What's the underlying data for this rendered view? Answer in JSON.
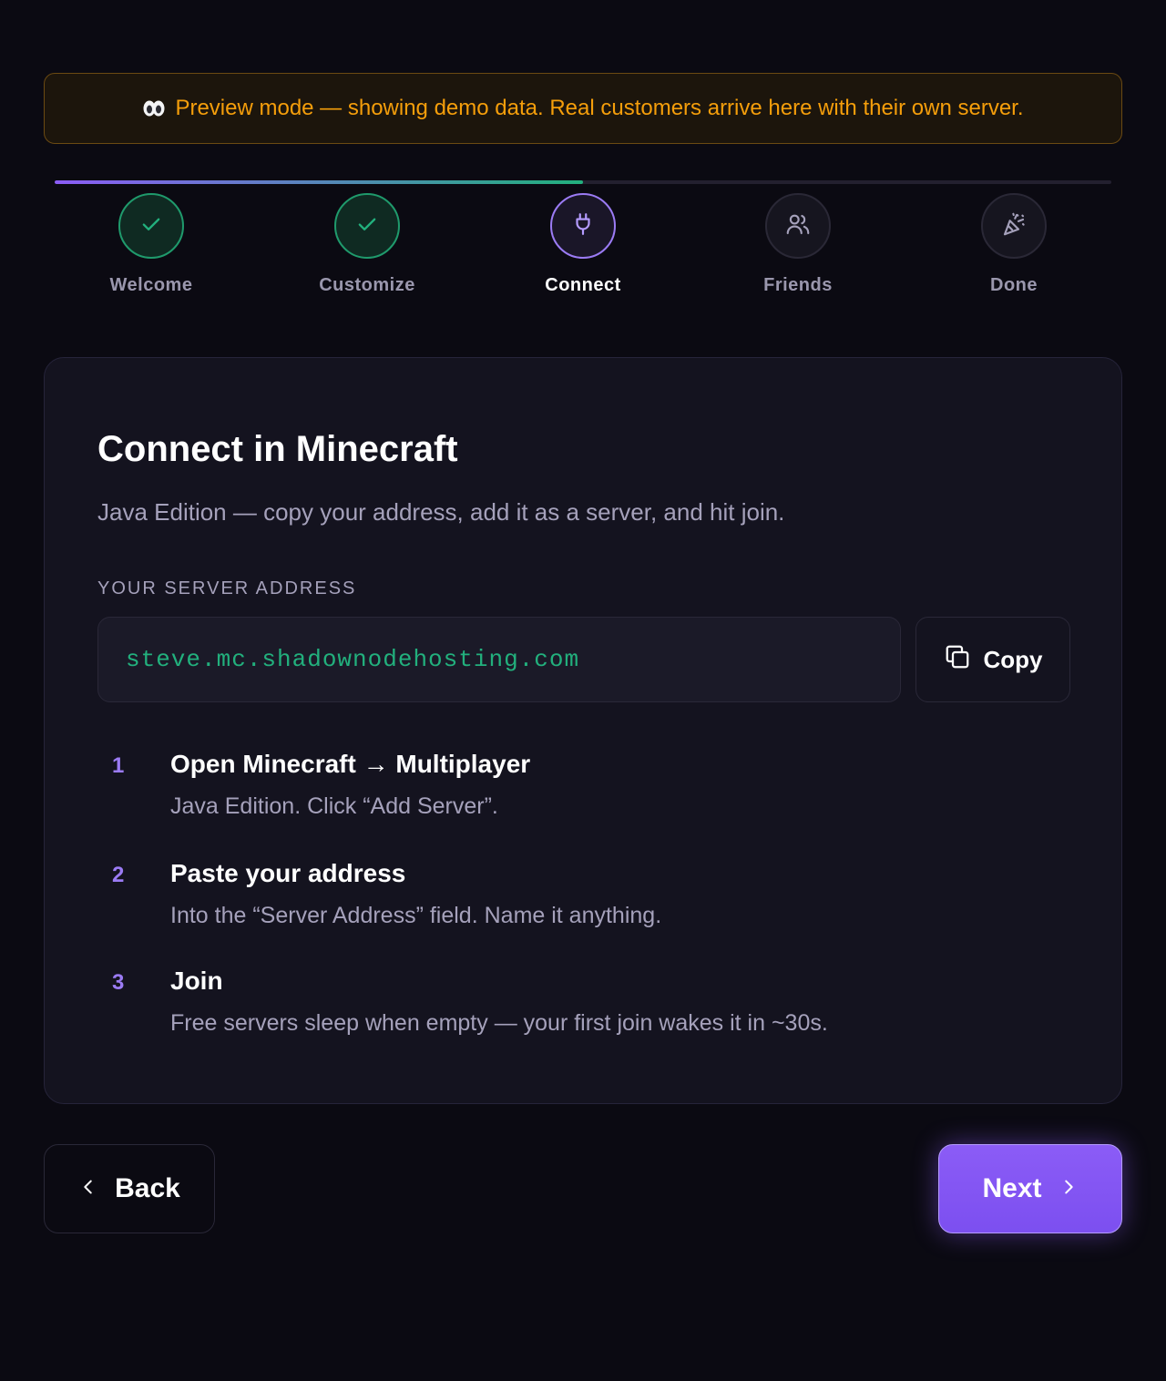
{
  "banner": {
    "icon": "eyes-icon",
    "text": "Preview mode — showing demo data. Real customers arrive here with their own server."
  },
  "progress": {
    "fraction": 0.5,
    "gradient_start": "#8b5cf6",
    "gradient_end": "#22b07d"
  },
  "steps": [
    {
      "label": "Welcome",
      "state": "done",
      "icon": "check-icon"
    },
    {
      "label": "Customize",
      "state": "done",
      "icon": "check-icon"
    },
    {
      "label": "Connect",
      "state": "active",
      "icon": "plug-icon"
    },
    {
      "label": "Friends",
      "state": "pending",
      "icon": "users-icon"
    },
    {
      "label": "Done",
      "state": "pending",
      "icon": "party-popper-icon"
    }
  ],
  "card": {
    "title": "Connect in Minecraft",
    "subtitle": "Java Edition — copy your address, add it as a server, and hit join.",
    "address_label": "YOUR SERVER ADDRESS",
    "address": "steve.mc.shadownodehosting.com",
    "copy_label": "Copy",
    "instructions": [
      {
        "num": "1",
        "title": "Open Minecraft → Multiplayer",
        "desc": "Java Edition. Click “Add Server”."
      },
      {
        "num": "2",
        "title": "Paste your address",
        "desc": "Into the “Server Address” field. Name it anything."
      },
      {
        "num": "3",
        "title": "Join",
        "desc": "Free servers sleep when empty — your first join wakes it in ~30s."
      }
    ]
  },
  "nav": {
    "back_label": "Back",
    "next_label": "Next"
  },
  "colors": {
    "accent": "#8b5cf6",
    "success": "#22b07d",
    "warning": "#f59e0b",
    "background": "#0b0a12",
    "card": "#14131f"
  }
}
